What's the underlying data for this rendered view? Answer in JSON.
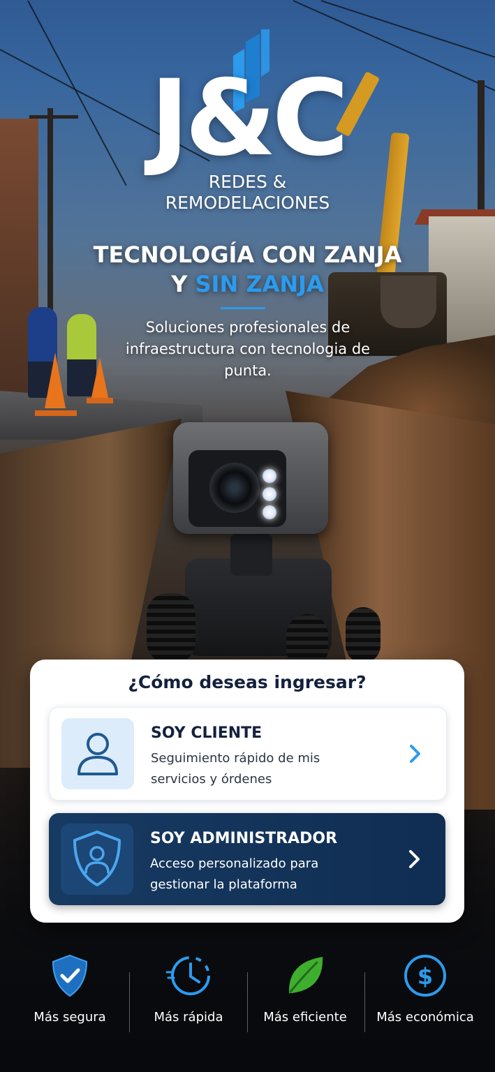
{
  "brand": {
    "logo_text": "J&C",
    "subtitle_line1": "REDES &",
    "subtitle_line2": "REMODELACIONES"
  },
  "hero": {
    "headline_line1": "TECNOLOGÍA CON ZANJA",
    "headline_line2_white": "Y ",
    "headline_line2_blue": "SIN ZANJA",
    "tagline": "Soluciones profesionales de infraestructura con tecnologia de punta."
  },
  "login_card": {
    "title": "¿Cómo deseas ingresar?",
    "options": [
      {
        "title": "SOY CLIENTE",
        "description": "Seguimiento rápido de mis servicios y órdenes",
        "icon": "user-icon"
      },
      {
        "title": "SOY ADMINISTRADOR",
        "description": "Acceso personalizado para gestionar la plataforma",
        "icon": "shield-user-icon"
      }
    ]
  },
  "features": [
    {
      "label": "Más segura",
      "icon": "shield-check-icon"
    },
    {
      "label": "Más rápida",
      "icon": "clock-icon"
    },
    {
      "label": "Más eficiente",
      "icon": "leaf-icon"
    },
    {
      "label": "Más económica",
      "icon": "dollar-icon"
    }
  ],
  "colors": {
    "accent_blue": "#2c9bee",
    "admin_navy": "#173a62",
    "client_icon_bg": "#dcecfb",
    "leaf_green": "#3fae2f"
  }
}
